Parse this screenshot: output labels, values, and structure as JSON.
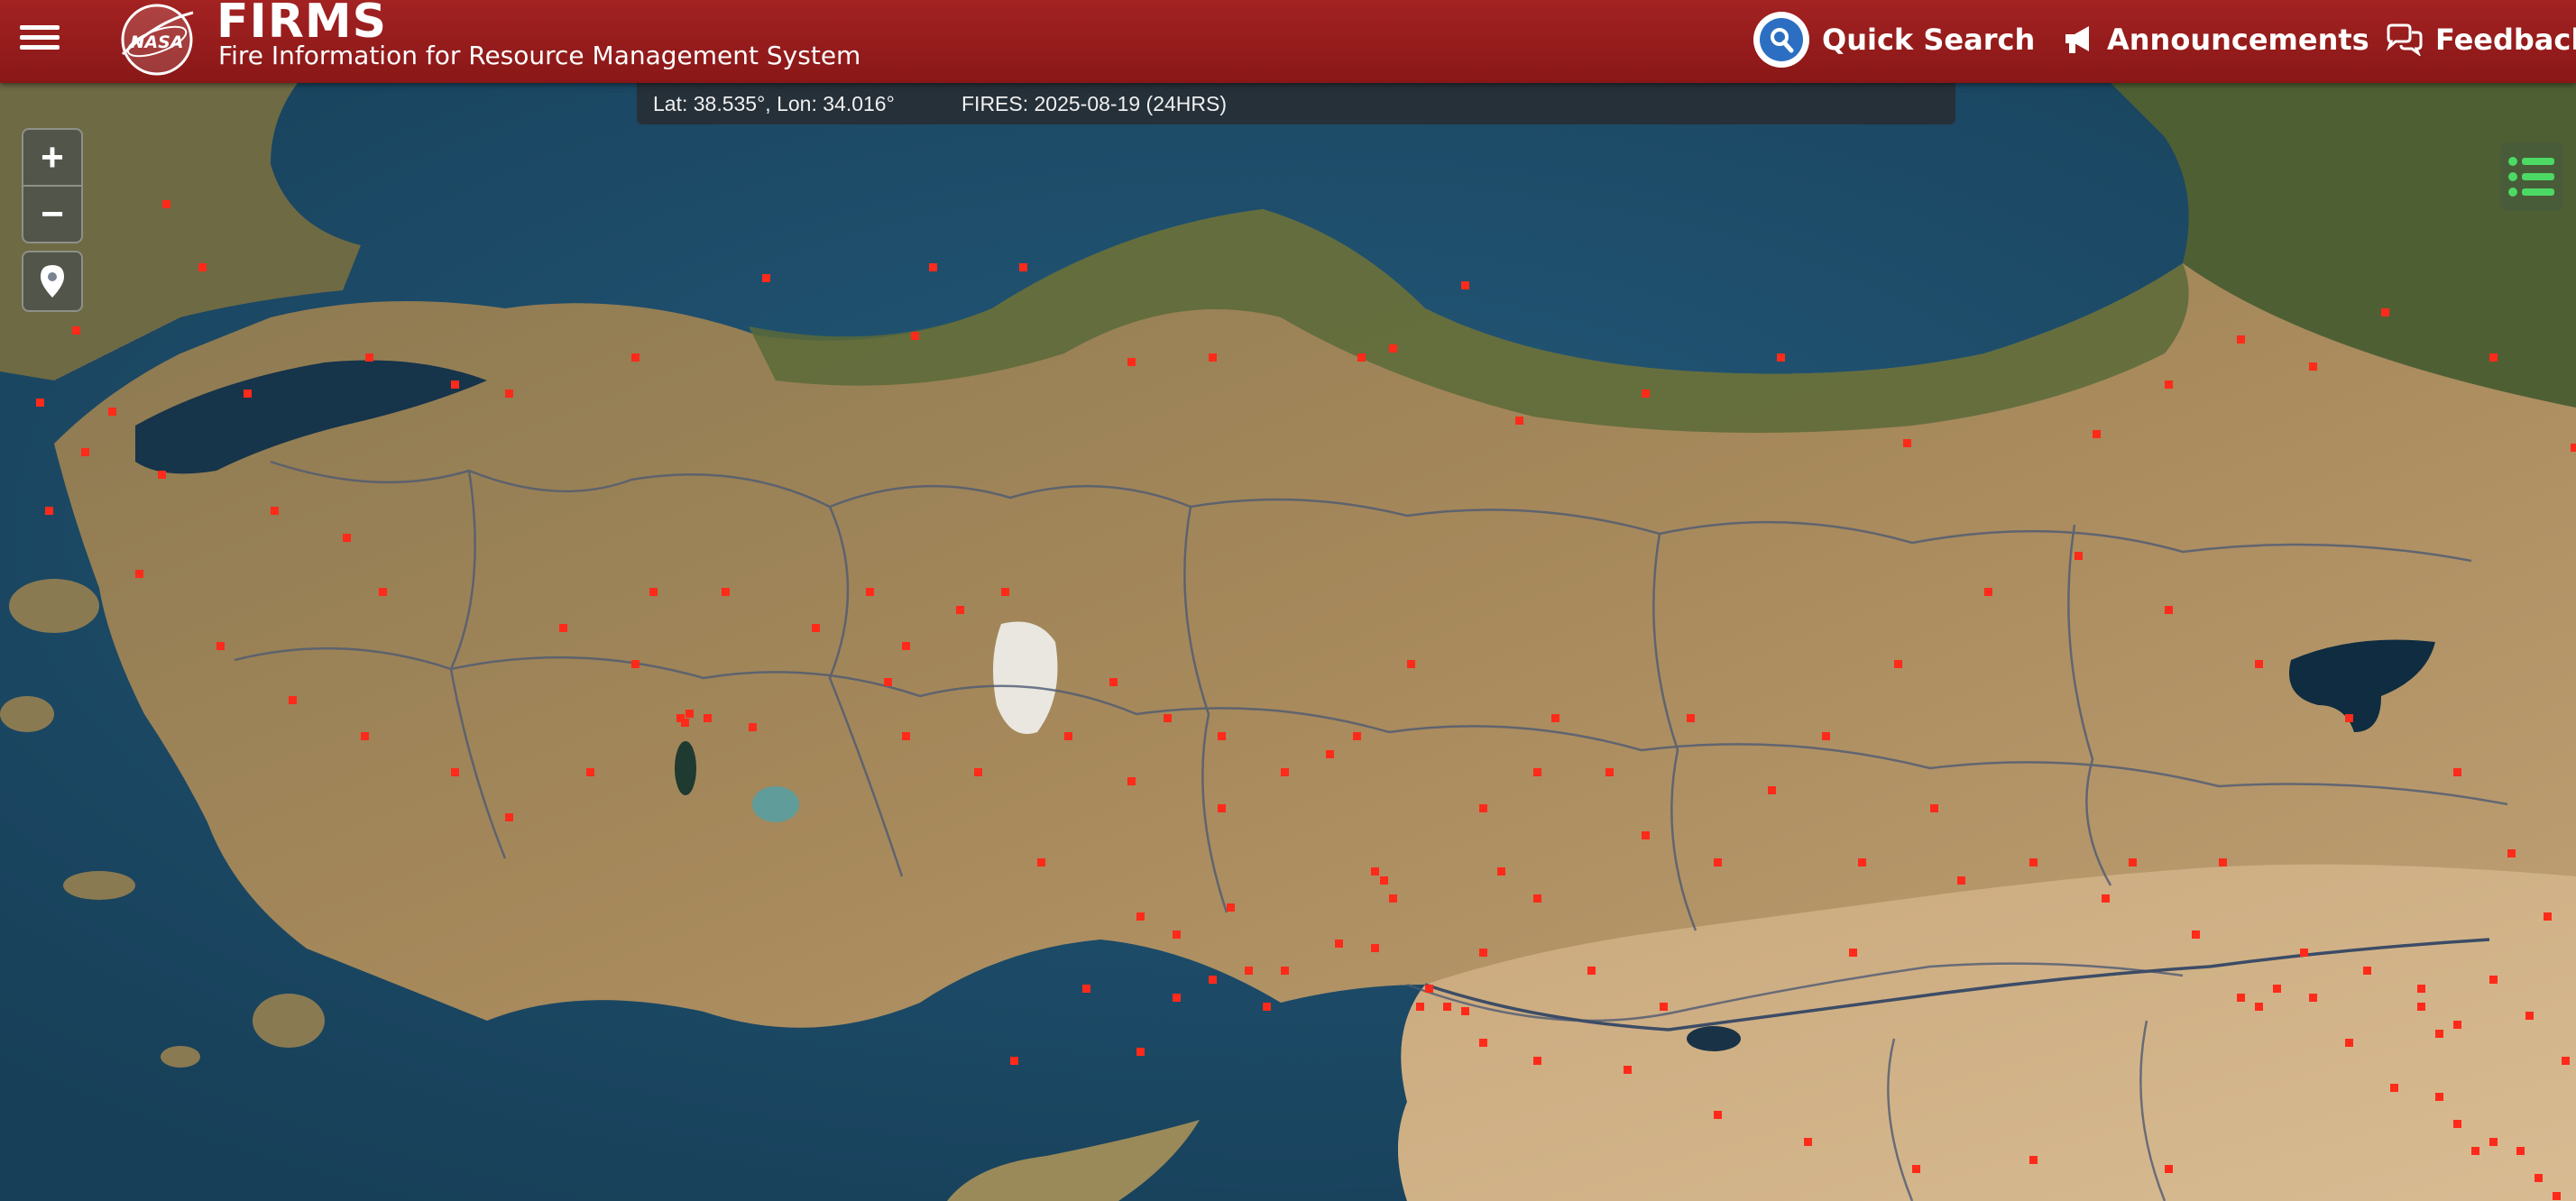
{
  "header": {
    "menu_icon": "hamburger-icon",
    "logo_icon": "nasa-logo-icon",
    "logo_text": "NASA",
    "title": "FIRMS",
    "subtitle": "Fire Information for Resource Management System",
    "nav": {
      "quick_search": "Quick Search",
      "announcements": "Announcements",
      "feedback": "Feedback"
    }
  },
  "info_bar": {
    "coordinates": "Lat: 38.535°, Lon: 34.016°",
    "fires": "FIRES: 2025-08-19 (24HRS)"
  },
  "controls": {
    "zoom_in": "+",
    "zoom_out": "−",
    "locate_icon": "map-pin-icon",
    "layers_icon": "layers-list-icon"
  },
  "colors": {
    "header": "#9a1c1c",
    "fire": "#ff2a1a",
    "sea": "#1d4a66",
    "land": "#a2855a",
    "layers_icon": "#4cd964"
  }
}
